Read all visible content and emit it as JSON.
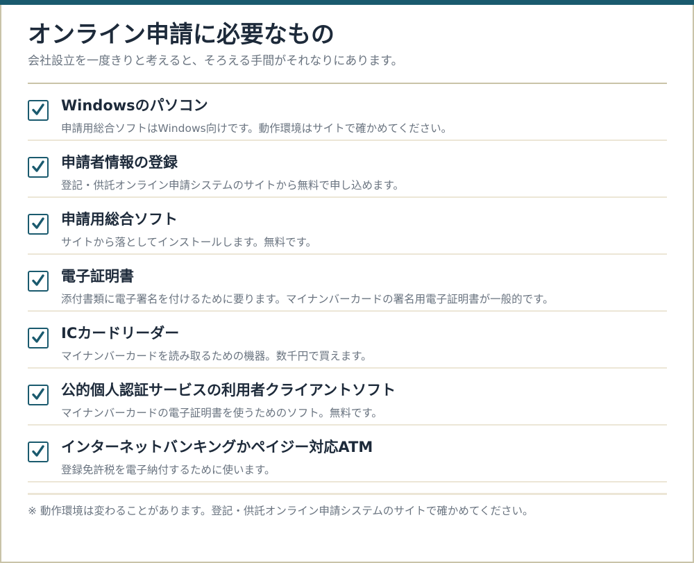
{
  "colors": {
    "accent": "#1a5a6e",
    "frame_border": "#c9c3a8",
    "divider": "#ece6d6",
    "title_text": "#1d2a3a",
    "muted_text": "#6a7480"
  },
  "header": {
    "title": "オンライン申請に必要なもの",
    "subtitle": "会社設立を一度きりと考えると、そろえる手間がそれなりにあります。"
  },
  "checklist": {
    "items": [
      {
        "checked": true,
        "icon": "checkmark-icon",
        "title": "Windowsのパソコン",
        "description": "申請用総合ソフトはWindows向けです。動作環境はサイトで確かめてください。"
      },
      {
        "checked": true,
        "icon": "checkmark-icon",
        "title": "申請者情報の登録",
        "description": "登記・供託オンライン申請システムのサイトから無料で申し込めます。"
      },
      {
        "checked": true,
        "icon": "checkmark-icon",
        "title": "申請用総合ソフト",
        "description": "サイトから落としてインストールします。無料です。"
      },
      {
        "checked": true,
        "icon": "checkmark-icon",
        "title": "電子証明書",
        "description": "添付書類に電子署名を付けるために要ります。マイナンバーカードの署名用電子証明書が一般的です。"
      },
      {
        "checked": true,
        "icon": "checkmark-icon",
        "title": "ICカードリーダー",
        "description": "マイナンバーカードを読み取るための機器。数千円で買えます。"
      },
      {
        "checked": true,
        "icon": "checkmark-icon",
        "title": "公的個人認証サービスの利用者クライアントソフト",
        "description": "マイナンバーカードの電子証明書を使うためのソフト。無料です。"
      },
      {
        "checked": true,
        "icon": "checkmark-icon",
        "title": "インターネットバンキングかペイジー対応ATM",
        "description": "登録免許税を電子納付するために使います。"
      }
    ]
  },
  "footer": {
    "note": "※ 動作環境は変わることがあります。登記・供託オンライン申請システムのサイトで確かめてください。"
  }
}
